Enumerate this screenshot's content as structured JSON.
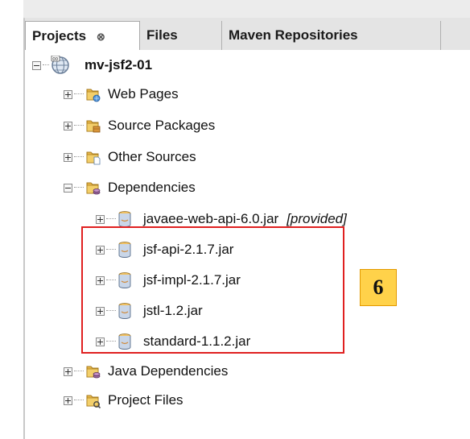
{
  "tabs": [
    {
      "label": "Projects",
      "close": "⊗",
      "active": true
    },
    {
      "label": "Files",
      "active": false
    },
    {
      "label": "Maven Repositories",
      "active": false
    }
  ],
  "tree": {
    "project": {
      "label": "mv-jsf2-01",
      "icon": "maven-project-icon"
    },
    "nodes": [
      {
        "label": "Web Pages",
        "icon": "web-pages-folder-icon"
      },
      {
        "label": "Source Packages",
        "icon": "source-packages-folder-icon"
      },
      {
        "label": "Other Sources",
        "icon": "other-sources-folder-icon"
      },
      {
        "label": "Dependencies",
        "icon": "dependencies-folder-icon"
      },
      {
        "label": "javaee-web-api-6.0.jar",
        "hint": "[provided]",
        "icon": "jar-icon"
      },
      {
        "label": "jsf-api-2.1.7.jar",
        "icon": "jar-icon"
      },
      {
        "label": "jsf-impl-2.1.7.jar",
        "icon": "jar-icon"
      },
      {
        "label": "jstl-1.2.jar",
        "icon": "jar-icon"
      },
      {
        "label": "standard-1.1.2.jar",
        "icon": "jar-icon"
      },
      {
        "label": "Java Dependencies",
        "icon": "java-dependencies-folder-icon"
      },
      {
        "label": "Project Files",
        "icon": "project-files-folder-icon"
      }
    ]
  },
  "annotation": {
    "number": "6",
    "highlight_color": "#e02020",
    "badge_color": "#ffd24a"
  }
}
